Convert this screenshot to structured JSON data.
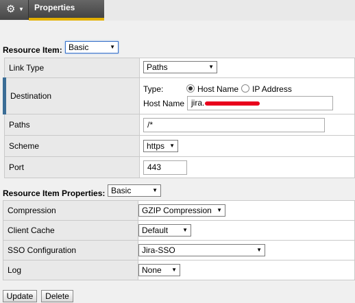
{
  "tab": {
    "label": "Properties"
  },
  "resource_item": {
    "label": "Resource Item:",
    "selected": "Basic"
  },
  "rows": {
    "link_type": {
      "label": "Link Type",
      "value": "Paths"
    },
    "destination": {
      "label": "Destination",
      "type_label": "Type:",
      "option_host": "Host Name",
      "option_ip": "IP Address",
      "host_label": "Host Name",
      "host_value": "jira."
    },
    "paths": {
      "label": "Paths",
      "value": "/*"
    },
    "scheme": {
      "label": "Scheme",
      "value": "https"
    },
    "port": {
      "label": "Port",
      "value": "443"
    }
  },
  "properties": {
    "label": "Resource Item Properties:",
    "selected": "Basic"
  },
  "prop_rows": {
    "compression": {
      "label": "Compression",
      "value": "GZIP Compression"
    },
    "client_cache": {
      "label": "Client Cache",
      "value": "Default"
    },
    "sso": {
      "label": "SSO Configuration",
      "value": "Jira-SSO"
    },
    "log": {
      "label": "Log",
      "value": "None"
    }
  },
  "buttons": {
    "update": "Update",
    "delete": "Delete"
  }
}
